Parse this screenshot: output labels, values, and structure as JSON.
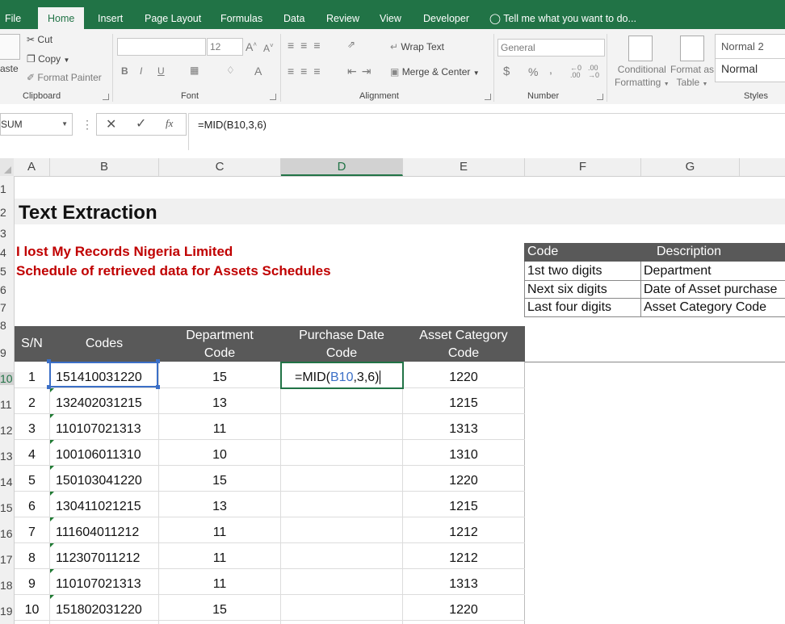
{
  "ribbon": {
    "tabs": [
      "File",
      "Home",
      "Insert",
      "Page Layout",
      "Formulas",
      "Data",
      "Review",
      "View",
      "Developer"
    ],
    "tell_me": "Tell me what you want to do...",
    "clipboard": {
      "paste": "aste",
      "cut": "Cut",
      "copy": "Copy",
      "format_painter": "Format Painter",
      "label": "Clipboard"
    },
    "font": {
      "size": "12",
      "label": "Font"
    },
    "alignment": {
      "wrap_text": "Wrap Text",
      "merge_center": "Merge & Center",
      "label": "Alignment"
    },
    "number": {
      "format": "General",
      "label": "Number",
      "currency": "$",
      "percent": "%",
      "comma": ","
    },
    "styles": {
      "conditional_1": "Conditional",
      "conditional_2": "Formatting",
      "format_as_1": "Format as",
      "format_as_2": "Table",
      "normal2": "Normal 2",
      "normal": "Normal",
      "label": "Styles"
    }
  },
  "formula_bar": {
    "name_box": "SUM",
    "formula": "=MID(B10,3,6)"
  },
  "columns": [
    "A",
    "B",
    "C",
    "D",
    "E",
    "F",
    "G"
  ],
  "rows": [
    "1",
    "2",
    "3",
    "4",
    "5",
    "6",
    "7",
    "8",
    "9",
    "10",
    "11",
    "12",
    "13",
    "14",
    "15",
    "16",
    "17",
    "18",
    "19"
  ],
  "sheet": {
    "title": "Text Extraction",
    "company": "I lost My Records Nigeria Limited",
    "subtitle": "Schedule of retrieved data for Assets Schedules",
    "headers": {
      "sn": "S/N",
      "codes": "Codes",
      "dept_1": "Department",
      "dept_2": "Code",
      "purchase_1": "Purchase Date",
      "purchase_2": "Code",
      "asset_1": "Asset Category",
      "asset_2": "Code"
    },
    "editing": {
      "prefix": "=MID(",
      "ref": "B10",
      "suffix": ",3,6)"
    },
    "data": [
      {
        "sn": "1",
        "code": "151410031220",
        "dept": "15",
        "asset": "1220"
      },
      {
        "sn": "2",
        "code": "132402031215",
        "dept": "13",
        "asset": "1215"
      },
      {
        "sn": "3",
        "code": "110107021313",
        "dept": "11",
        "asset": "1313"
      },
      {
        "sn": "4",
        "code": "100106011310",
        "dept": "10",
        "asset": "1310"
      },
      {
        "sn": "5",
        "code": "150103041220",
        "dept": "15",
        "asset": "1220"
      },
      {
        "sn": "6",
        "code": "130411021215",
        "dept": "13",
        "asset": "1215"
      },
      {
        "sn": "7",
        "code": "111604011212",
        "dept": "11",
        "asset": "1212"
      },
      {
        "sn": "8",
        "code": "112307011212",
        "dept": "11",
        "asset": "1212"
      },
      {
        "sn": "9",
        "code": "110107021313",
        "dept": "11",
        "asset": "1313"
      },
      {
        "sn": "10",
        "code": "151802031220",
        "dept": "15",
        "asset": "1220"
      }
    ],
    "legend": {
      "code_header": "Code",
      "desc_header": "Description",
      "rows": [
        {
          "code": "1st two digits",
          "desc": "Department"
        },
        {
          "code": "Next six digits",
          "desc": "Date of Asset purchase"
        },
        {
          "code": "Last four digits",
          "desc": "Asset Category Code"
        }
      ]
    }
  },
  "colors": {
    "accent": "#217346",
    "title_red": "#c00000",
    "header_fill": "#595959",
    "ref_blue": "#3b6fc7"
  }
}
